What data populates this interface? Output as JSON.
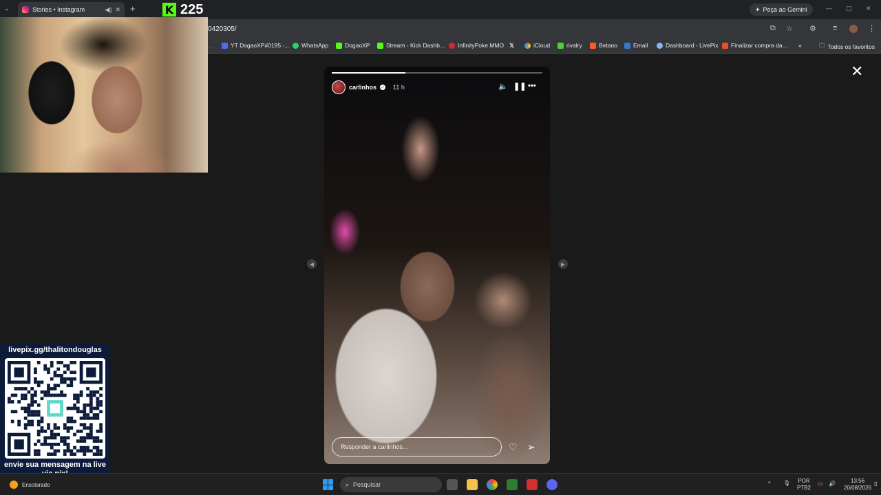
{
  "browser": {
    "tab_title": "Stories • Instagram",
    "url_fragment": "0420305/",
    "gemini_label": "Peça ao Gemini",
    "bookmarks": [
      {
        "label": "YT DogaoXP#0195 -...",
        "color": "#4f6cf0"
      },
      {
        "label": "WhatsApp",
        "color": "#25d366"
      },
      {
        "label": "DogaoXP",
        "color": "#53fc18"
      },
      {
        "label": "Stream - Kick Dashb...",
        "color": "#53fc18"
      },
      {
        "label": "InfinityPoke MMO",
        "color": "#d6262e"
      },
      {
        "label": "",
        "color": "#ffffff"
      },
      {
        "label": "iCloud",
        "color": "#9aa0a6"
      },
      {
        "label": "rivalry",
        "color": "#4cd137"
      },
      {
        "label": "Betano",
        "color": "#ff5a1f"
      },
      {
        "label": "Email",
        "color": "#2f7bd6"
      },
      {
        "label": "Dashboard - LivePix",
        "color": "#8ab4f8"
      },
      {
        "label": "Finalizar compra da...",
        "color": "#ee4d2d"
      }
    ],
    "all_favorites": "Todos os favoritos"
  },
  "story": {
    "username": "carlinhos",
    "time": "11 h",
    "progress": 0.35,
    "reply_placeholder": "Responder a carlinhos..."
  },
  "overlay": {
    "kick_viewers": "225",
    "livepix_url": "livepix.gg/thalitondouglas",
    "livepix_message": "envie sua mensagem na live via pix!"
  },
  "taskbar": {
    "weather": "Ensolarado",
    "search": "Pesquisar",
    "lang": "POR",
    "lang_sub": "PTB2",
    "time": "13:56",
    "date": "20/08/2026"
  },
  "colors": {
    "kick_green": "#53fc18",
    "livepix_bg": "#0d1b3a",
    "windows_blue": "#2b9cf2"
  }
}
